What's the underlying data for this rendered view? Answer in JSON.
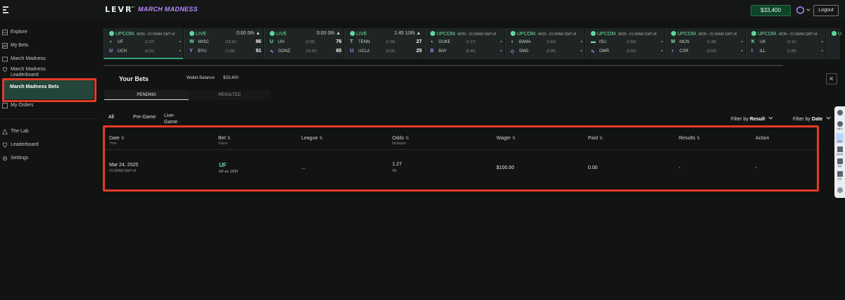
{
  "header": {
    "logo": "LEVR",
    "logo_sub": "BET",
    "brand_title": "MARCH MADNESS",
    "balance": "$33,400",
    "logout": "Logout"
  },
  "sidebar": {
    "items": [
      {
        "label": "Explore",
        "icon": "compass-icon"
      },
      {
        "label": "My Bets",
        "icon": "bets-icon"
      },
      {
        "label": "March Madness",
        "icon": "basketball-icon"
      },
      {
        "label": "March Madness Leaderboard",
        "icon": "trophy-icon"
      },
      {
        "label": "March Madness Bets",
        "icon": "ticket-icon"
      },
      {
        "label": "My Orders",
        "icon": "orders-icon"
      },
      {
        "label": "The Lab",
        "icon": "flask-icon"
      },
      {
        "label": "Leaderboard",
        "icon": "leaderboard-icon"
      },
      {
        "label": "Settings",
        "icon": "gear-icon"
      }
    ]
  },
  "ticker": {
    "cards": [
      {
        "status": "UPCOM.",
        "time": "MON - 01:00AM GMT+8",
        "right": "",
        "t1": {
          "name": "UF",
          "odds": "(1.27)",
          "score": "-"
        },
        "t2": {
          "name": "UCH",
          "odds": "(4.31)",
          "score": "-"
        }
      },
      {
        "status": "LIVE",
        "time": "",
        "right": "0:00  0th ▲",
        "t1": {
          "name": "WISC",
          "odds": "(12.31)",
          "score": "86"
        },
        "t2": {
          "name": "BYU",
          "odds": "(1.03)",
          "score": "91"
        }
      },
      {
        "status": "LIVE",
        "time": "",
        "right": "0:00  0th ▲",
        "t1": {
          "name": "UH",
          "odds": "(1.02)",
          "score": "76"
        },
        "t2": {
          "name": "GONZ",
          "odds": "(15.42)",
          "score": "65"
        }
      },
      {
        "status": "LIVE",
        "time": "",
        "right": "1:45  10th ▲",
        "t1": {
          "name": "TENN",
          "odds": "(1.33)",
          "score": "27"
        },
        "t2": {
          "name": "UCLA",
          "odds": "(3.25)",
          "score": "25"
        }
      },
      {
        "status": "UPCOM.",
        "time": "MON - 01:00AM GMT+8",
        "right": "",
        "t1": {
          "name": "DUKE",
          "odds": "(1.17)",
          "score": "-"
        },
        "t2": {
          "name": "BAY",
          "odds": "(6.45)",
          "score": "-"
        }
      },
      {
        "status": "UPCOM.",
        "time": "MON - 01:00AM GMT+8",
        "right": "",
        "t1": {
          "name": "BAMA",
          "odds": "(1.49)",
          "score": "-"
        },
        "t2": {
          "name": "SMG",
          "odds": "(2.95)",
          "score": "-"
        }
      },
      {
        "status": "UPCOM.",
        "time": "MON - 01:00AM GMT+8",
        "right": "",
        "t1": {
          "name": "ISU",
          "odds": "(1.50)",
          "score": "-"
        },
        "t2": {
          "name": "OMR",
          "odds": "(2.92)",
          "score": "-"
        }
      },
      {
        "status": "UPCOM.",
        "time": "MON - 01:00AM GMT+8",
        "right": "",
        "t1": {
          "name": "MCN",
          "odds": "(1.38)",
          "score": "-"
        },
        "t2": {
          "name": "CSR",
          "odds": "(3.52)",
          "score": "-"
        }
      },
      {
        "status": "UPCOM.",
        "time": "MON - 01:00AM GMT+8",
        "right": "",
        "t1": {
          "name": "UK",
          "odds": "(2.11)",
          "score": "-"
        },
        "t2": {
          "name": "ILL",
          "odds": "(1.85)",
          "score": "-"
        }
      },
      {
        "status": "U",
        "time": "",
        "right": "",
        "t1": {
          "name": "",
          "odds": "",
          "score": ""
        },
        "t2": {
          "name": "",
          "odds": "",
          "score": ""
        }
      }
    ]
  },
  "main": {
    "title": "Your Bets",
    "wallet_label": "Wallet Balance",
    "wallet_value": "$33,400",
    "tabs": {
      "pending": "PENDING",
      "resulted": "RESULTED"
    },
    "filters": {
      "all": "All",
      "pregame": "Pre-Game",
      "live": "Live-Game"
    },
    "filter_result": {
      "label": "Filter by",
      "value": "Result"
    },
    "filter_date": {
      "label": "Filter by",
      "value": "Date"
    }
  },
  "table": {
    "headers": {
      "date": "Date",
      "date_sub": "Time",
      "bet": "Bet",
      "bet_sub": "Game",
      "league": "League",
      "odds": "Odds",
      "odds_sub": "Multiplier",
      "wager": "Wager",
      "paid": "Paid",
      "results": "Results",
      "action": "Action"
    },
    "rows": [
      {
        "date": "Mar 24, 2025",
        "time": "01:00AM GMT+8",
        "bet": "UF",
        "game": "UF vs. UCH",
        "league": "...",
        "odds": "1.27",
        "multiplier": "4x",
        "wager": "$100.00",
        "paid": "0.00",
        "results": "-",
        "action": "-"
      }
    ]
  },
  "sidepanel": {
    "items": [
      "AI助手",
      "翻译",
      "截全屏",
      "录屏",
      "搜索"
    ]
  },
  "colors": {
    "accent_green": "#6fe0a4",
    "brand_purple": "#b48cff",
    "highlight_red": "#e23b25"
  }
}
